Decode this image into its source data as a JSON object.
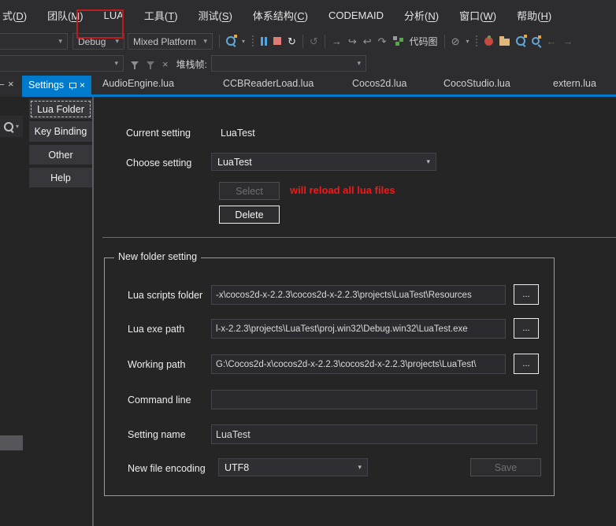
{
  "menu": {
    "items": [
      "式(D)",
      "团队(M)",
      "LUA",
      "工具(T)",
      "测试(S)",
      "体系结构(C)",
      "CODEMAID",
      "分析(N)",
      "窗口(W)",
      "帮助(H)"
    ]
  },
  "toolbar": {
    "config": "Debug",
    "platform": "Mixed Platform",
    "code_map_label": "代码图"
  },
  "debug_bar": {
    "stack_frame_label": "堆栈帧:"
  },
  "tabs": {
    "active": "Settings",
    "items": [
      "AudioEngine.lua",
      "CCBReaderLoad.lua",
      "Cocos2d.lua",
      "CocoStudio.lua",
      "extern.lua"
    ]
  },
  "sidebar": {
    "items": [
      "Lua Folder",
      "Key Binding",
      "Other",
      "Help"
    ]
  },
  "settings": {
    "current_setting_label": "Current setting",
    "current_setting_value": "LuaTest",
    "choose_setting_label": "Choose setting",
    "choose_setting_value": "LuaTest",
    "select_button": "Select",
    "select_warning": "will reload all lua files",
    "delete_button": "Delete"
  },
  "group": {
    "title": "New folder setting",
    "browse_button": "...",
    "save_button": "Save",
    "rows": [
      {
        "label": "Lua scripts folder",
        "value": "-x\\cocos2d-x-2.2.3\\cocos2d-x-2.2.3\\projects\\LuaTest\\Resources"
      },
      {
        "label": "Lua exe path",
        "value": "l-x-2.2.3\\projects\\LuaTest\\proj.win32\\Debug.win32\\LuaTest.exe"
      },
      {
        "label": "Working path",
        "value": "G:\\Cocos2d-x\\cocos2d-x-2.2.3\\cocos2d-x-2.2.3\\projects\\LuaTest\\"
      },
      {
        "label": "Command line",
        "value": ""
      },
      {
        "label": "Setting name",
        "value": "LuaTest"
      },
      {
        "label": "New file encoding",
        "value": "UTF8"
      }
    ]
  },
  "icons": {
    "close": "×",
    "chevron": "▾",
    "restart": "↻",
    "refresh": "↺",
    "continue_arrow": "→",
    "step_into": "↪",
    "step_out": "↩",
    "step_over": "↷",
    "disable_breakpoints": "⊘",
    "swap_cross": "×",
    "nav_back": "←",
    "nav_forward": "→",
    "minimize_dash": "–"
  },
  "colors": {
    "accent": "#007acc",
    "warning_red": "#fb1515",
    "highlight_red": "#bf1d1d",
    "stop_red": "#e07b74",
    "pause_blue": "#4ea6ea"
  }
}
